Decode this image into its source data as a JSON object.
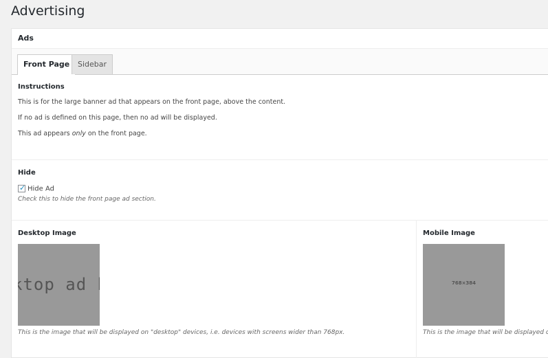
{
  "page": {
    "title": "Advertising"
  },
  "panel": {
    "title": "Ads"
  },
  "tabs": [
    {
      "label": "Front Page",
      "active": true
    },
    {
      "label": "Sidebar",
      "active": false
    }
  ],
  "instructions": {
    "label": "Instructions",
    "line1": "This is for the large banner ad that appears on the front page, above the content.",
    "line2": "If no ad is defined on this page, then no ad will be displayed.",
    "line3_prefix": "This ad appears ",
    "line3_emphasis": "only",
    "line3_suffix": " on the front page."
  },
  "hide": {
    "label": "Hide",
    "checkbox_label": "Hide Ad",
    "checked": true,
    "description": "Check this to hide the front page ad section."
  },
  "desktop_image": {
    "label": "Desktop Image",
    "preview_text": "ktop ad bar",
    "description": "This is the image that will be displayed on \"desktop\" devices, i.e. devices with screens wider than 768px."
  },
  "mobile_image": {
    "label": "Mobile Image",
    "preview_text": "768×384",
    "description": "This is the image that will be displayed o"
  },
  "colors": {
    "background": "#f1f1f1",
    "panel": "#ffffff",
    "checkmark": "#1e8cbe",
    "image_placeholder": "#999999"
  }
}
